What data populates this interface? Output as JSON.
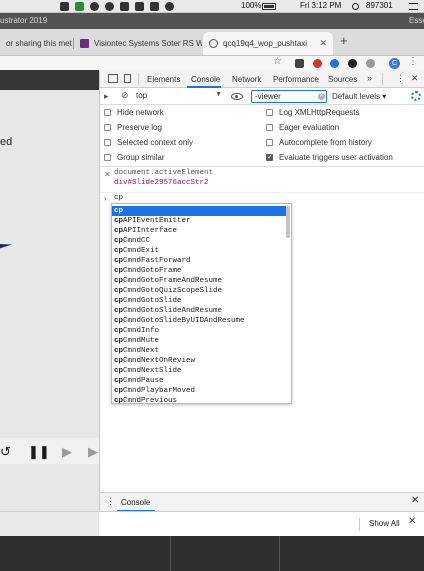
{
  "menubar": {
    "battery_label": "100%",
    "clock": "Fri 3:12 PM",
    "count": "897301"
  },
  "illustrator": {
    "title": "ustrator 2019",
    "right": "Esse"
  },
  "tabs": [
    {
      "label": "or sharing this met",
      "active": false
    },
    {
      "label": "Visiontec Systems Soter RS W",
      "active": false
    },
    {
      "label": "qcq19q4_wop_pushtaxi",
      "active": true
    }
  ],
  "toolbar": {
    "avatar_letter": "C",
    "more_glyph": "⋮",
    "star_glyph": "☆"
  },
  "page": {
    "text": "ed"
  },
  "devtools": {
    "tabs": [
      "Elements",
      "Console",
      "Network",
      "Performance",
      "Sources"
    ],
    "active_tab": "Console",
    "more_tabs_glyph": "»",
    "context": "top",
    "filter_value": "-viewer",
    "levels": "Default levels",
    "settings": {
      "left": [
        {
          "label": "Hide network",
          "checked": false
        },
        {
          "label": "Preserve log",
          "checked": false
        },
        {
          "label": "Selected context only",
          "checked": false
        },
        {
          "label": "Group similar",
          "checked": false
        }
      ],
      "right": [
        {
          "label": "Log XMLHttpRequests",
          "checked": false
        },
        {
          "label": "Eager evaluation",
          "checked": false
        },
        {
          "label": "Autocomplete from history",
          "checked": false
        },
        {
          "label": "Evaluate triggers user activation",
          "checked": true
        }
      ]
    },
    "console": {
      "entry_expr": "document.activeElement",
      "entry_result": "div#Slide29576accStr2",
      "prompt_input": "cp"
    },
    "autocomplete": {
      "prefix": "cp",
      "items": [
        "",
        "APIEventEmitter",
        "APIInterface",
        "CmndCC",
        "CmndExit",
        "CmndFastForward",
        "CmndGotoFrame",
        "CmndGotoFrameAndResume",
        "CmndGotoQuizScopeSlide",
        "CmndGotoSlide",
        "CmndGotoSlideAndResume",
        "CmndGotoSlideByUIDAndResume",
        "CmndInfo",
        "CmndMute",
        "CmndNext",
        "CmndNextOnReview",
        "CmndNextSlide",
        "CmndPause",
        "CmndPlaybarMoved",
        "CmndPrevious"
      ]
    },
    "drawer": {
      "tab": "Console"
    }
  },
  "download_bar": {
    "show_all": "Show All"
  }
}
